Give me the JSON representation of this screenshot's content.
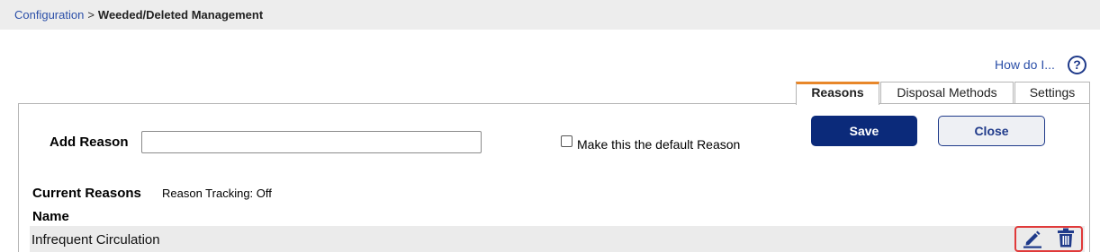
{
  "breadcrumb": {
    "parent": "Configuration",
    "separator": ">",
    "current": "Weeded/Deleted Management"
  },
  "help": {
    "label": "How do I...",
    "icon": "question-circle-icon",
    "icon_glyph": "?"
  },
  "tabs": [
    {
      "label": "Reasons",
      "active": true
    },
    {
      "label": "Disposal Methods",
      "active": false
    },
    {
      "label": "Settings",
      "active": false
    }
  ],
  "form": {
    "add_label": "Add Reason",
    "add_value": "",
    "default_checkbox_checked": false,
    "default_label": "Make this the default Reason"
  },
  "buttons": {
    "save": "Save",
    "close": "Close"
  },
  "reasons": {
    "heading": "Current Reasons",
    "tracking": "Reason Tracking: Off",
    "column_name": "Name",
    "rows": [
      {
        "name": "Infrequent Circulation",
        "actions": [
          "pencil-edit-icon",
          "trash-delete-icon"
        ]
      }
    ]
  },
  "colors": {
    "active_tab_accent": "#e8872a",
    "primary_button": "#0b2a7a",
    "link": "#2b4fa8",
    "highlight_border": "#e03a3a"
  }
}
